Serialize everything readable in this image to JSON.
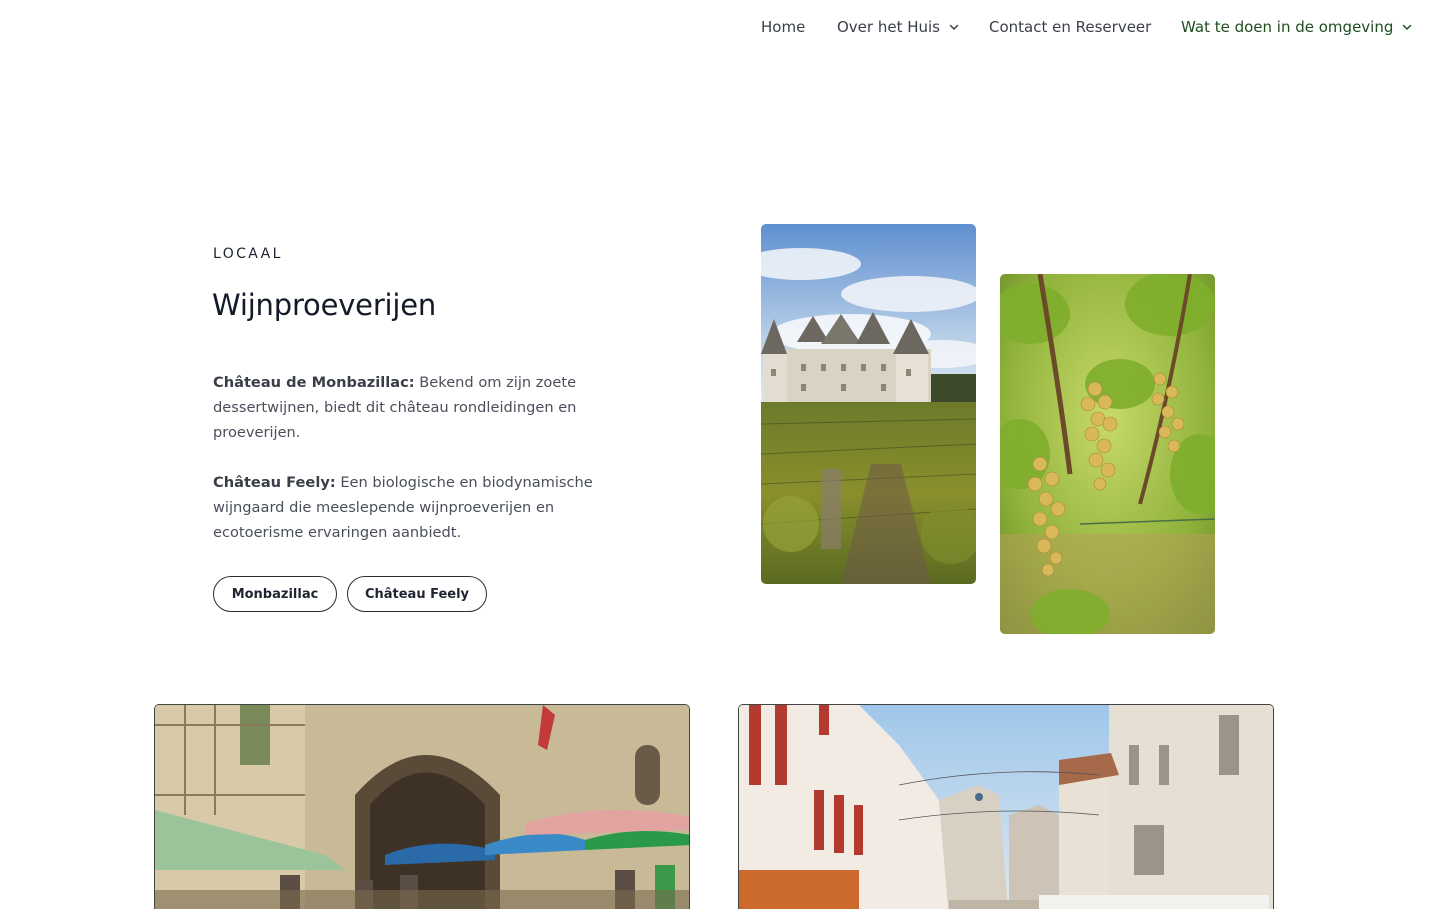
{
  "nav": {
    "items": [
      {
        "label": "Home",
        "has_dropdown": false,
        "active": false
      },
      {
        "label": "Over het Huis",
        "has_dropdown": true,
        "active": false
      },
      {
        "label": "Contact en Reserveer",
        "has_dropdown": false,
        "active": false
      },
      {
        "label": "Wat te doen in de omgeving",
        "has_dropdown": true,
        "active": true
      }
    ],
    "text_color": "#3b3f4a",
    "active_color": "#1f4d1e"
  },
  "section": {
    "eyebrow": "LOCAAL",
    "title": "Wijnproeverijen",
    "entries": [
      {
        "name": "Château de Monbazillac:",
        "text": "Bekend om zijn zoete dessertwijnen, biedt dit château rondleidingen en proeverijen."
      },
      {
        "name": "Château Feely:",
        "text": "Een biologische en biodynamische wijngaard die meeslepende wijnproeverijen en ecotoerisme ervaringen aanbiedt."
      }
    ],
    "buttons": [
      {
        "label": "Monbazillac"
      },
      {
        "label": "Château Feely"
      }
    ]
  },
  "images": [
    {
      "name": "castle-vineyard-image",
      "subject": "château with vineyard"
    },
    {
      "name": "grapes-image",
      "subject": "white grape bunches on vine"
    },
    {
      "name": "market-image",
      "subject": "market square with umbrellas"
    },
    {
      "name": "street-image",
      "subject": "village street"
    }
  ]
}
